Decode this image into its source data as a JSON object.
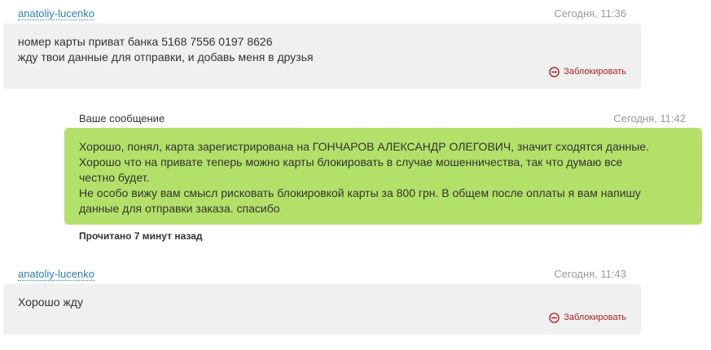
{
  "messages": {
    "first": {
      "author": "anatoliy-lucenko",
      "time": "Сегодня, 11:36",
      "lines": [
        "номер карты приват банка 5168 7556 0197 8626",
        "жду твои данные для отправки, и добавь меня в друзья"
      ],
      "block_label": "Заблокировать"
    },
    "reply": {
      "label": "Ваше сообщение",
      "time": "Сегодня, 11:42",
      "lines": [
        "Хорошо, понял, карта зарегистрирована на ГОНЧАРОВ АЛЕКСАНДР ОЛЕГОВИЧ, значит сходятся данные.",
        "Хорошо что на привате теперь можно карты блокировать в случае мошенничества, так что думаю все",
        "честно будет.",
        "Не особо вижу вам смысл рисковать блокировкой карты за 800 грн. В общем после оплаты я вам напишу",
        "данные для отправки заказа. спасибо"
      ],
      "read_status": "Прочитано 7 минут назад"
    },
    "second": {
      "author": "anatoliy-lucenko",
      "time": "Сегодня, 11:43",
      "lines": [
        "Хорошо жду"
      ],
      "block_label": "Заблокировать"
    }
  },
  "icons": {
    "block": "block-icon"
  },
  "colors": {
    "incoming_bg": "#f0f0f0",
    "outgoing_bg": "#b3e068",
    "link": "#2a7fb8",
    "block": "#b22222",
    "timestamp": "#999999"
  }
}
